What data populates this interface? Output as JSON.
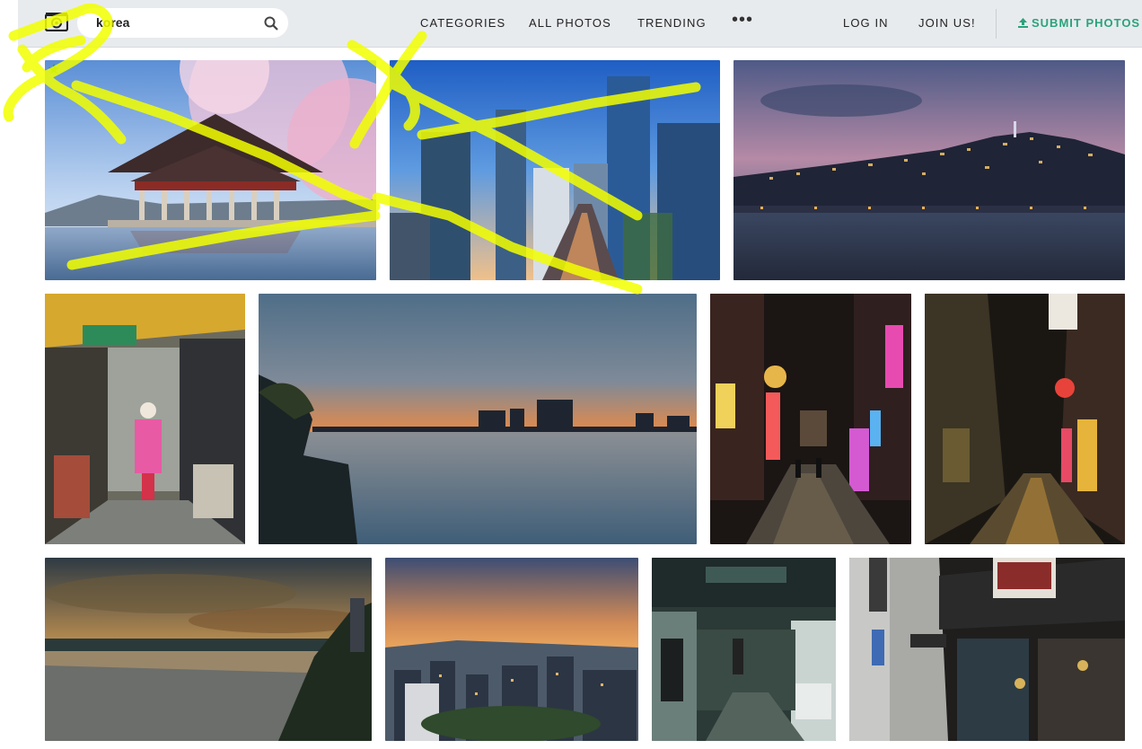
{
  "header": {
    "logo_icon": "camera-icon",
    "search": {
      "value": "korea",
      "icon": "search-icon"
    },
    "nav": [
      {
        "label": "CATEGORIES"
      },
      {
        "label": "ALL PHOTOS"
      },
      {
        "label": "TRENDING"
      }
    ],
    "more_label": "•••",
    "login_label": "LOG IN",
    "join_label": "JOIN US!",
    "submit_label": "SUBMIT PHOTOS",
    "submit_icon": "upload-icon"
  },
  "colors": {
    "accent": "#2aa37a",
    "header_bg": "#e8ebee",
    "star": "#1f9b2f",
    "scribble": "#f2ff00"
  },
  "photos": [
    {
      "id": "gyeongbokgung-pavilion",
      "featured": true
    },
    {
      "id": "seoul-skyscrapers",
      "featured": true
    },
    {
      "id": "hillside-city-night",
      "featured": false
    },
    {
      "id": "market-alley",
      "featured": false
    },
    {
      "id": "han-river-sunset",
      "featured": false
    },
    {
      "id": "neon-street-night",
      "featured": false
    },
    {
      "id": "wet-alley-night",
      "featured": false
    },
    {
      "id": "river-sunset-cloudy",
      "featured": false
    },
    {
      "id": "city-skyline-dusk",
      "featured": false
    },
    {
      "id": "fish-market",
      "featured": false
    },
    {
      "id": "shopfront-street",
      "featured": false
    }
  ]
}
